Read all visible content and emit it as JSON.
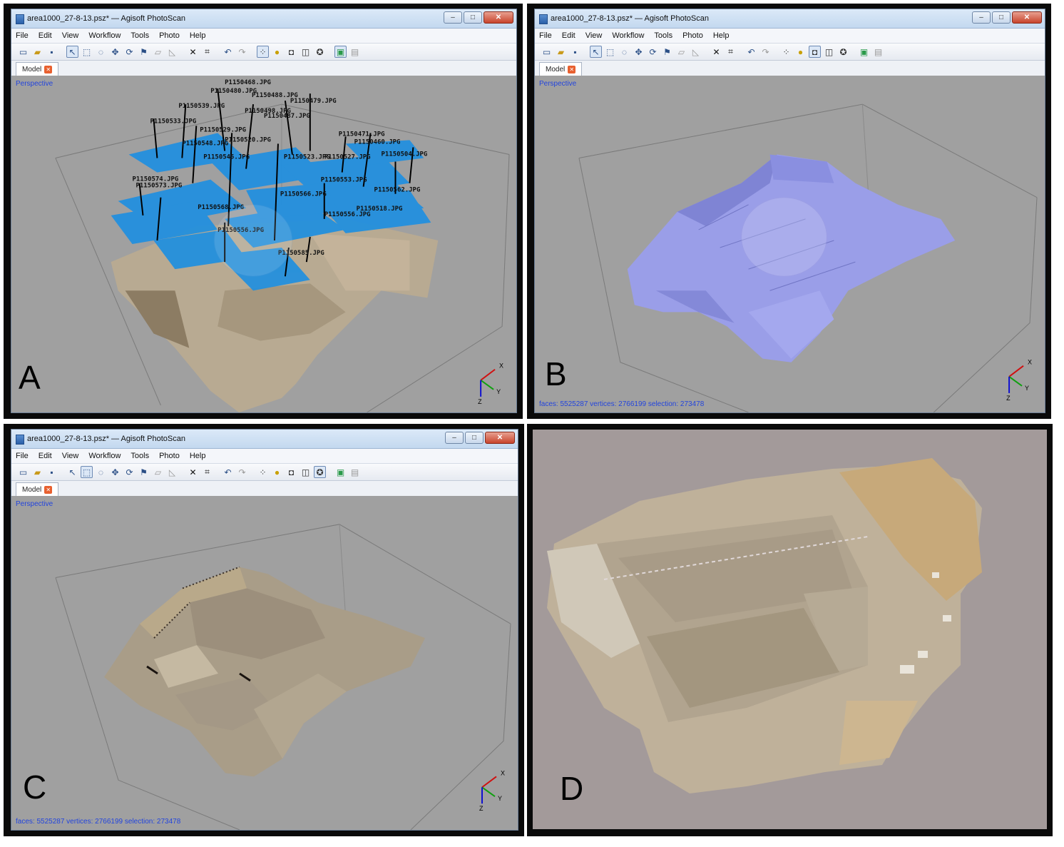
{
  "windows": {
    "a": {
      "title": "area1000_27-8-13.psz* — Agisoft PhotoScan",
      "view_mode": "Perspective",
      "panel_label": "A",
      "camera_labels": [
        "P1150468.JPG",
        "P1150480.JPG",
        "P1150488.JPG",
        "P1150479.JPG",
        "P1150539.JPG",
        "P1150498.JPG",
        "P1150487.JPG",
        "P1150533.JPG",
        "P1150529.JPG",
        "P1150471.JPG",
        "P1150548.JPG",
        "P1150520.JPG",
        "P1150460.JPG",
        "P1150545.JPG",
        "P1150523.JPG",
        "P1150504.JPG",
        "P1150527.JPG",
        "P1150574.JPG",
        "P1150573.JPG",
        "P1150553.JPG",
        "P1150568.JPG",
        "P1150585.JPG",
        "P1150562.JPG",
        "P1150518.JPG",
        "P1150556.JPG",
        "P1150566.JPG",
        "P1150556.JPG"
      ]
    },
    "b": {
      "title": "area1000_27-8-13.psz* — Agisoft PhotoScan",
      "view_mode": "Perspective",
      "panel_label": "B",
      "stats": "faces: 5525287 vertices: 2766199 selection: 273478"
    },
    "c": {
      "title": "area1000_27-8-13.psz* — Agisoft PhotoScan",
      "view_mode": "Perspective",
      "panel_label": "C",
      "stats": "faces: 5525287 vertices: 2766199 selection: 273478"
    }
  },
  "panel_d_label": "D",
  "menu": {
    "file": "File",
    "edit": "Edit",
    "view": "View",
    "workflow": "Workflow",
    "tools": "Tools",
    "photo": "Photo",
    "help": "Help"
  },
  "tab_label": "Model",
  "axis": {
    "x": "X",
    "y": "Y",
    "z": "Z"
  },
  "colors": {
    "viewport_bg": "#a0a0a0",
    "camera_plane": "#1f8fe0",
    "mesh": "#9a9ee8",
    "ortho_bg": "#a39a9a",
    "info_text": "#2244dd"
  }
}
